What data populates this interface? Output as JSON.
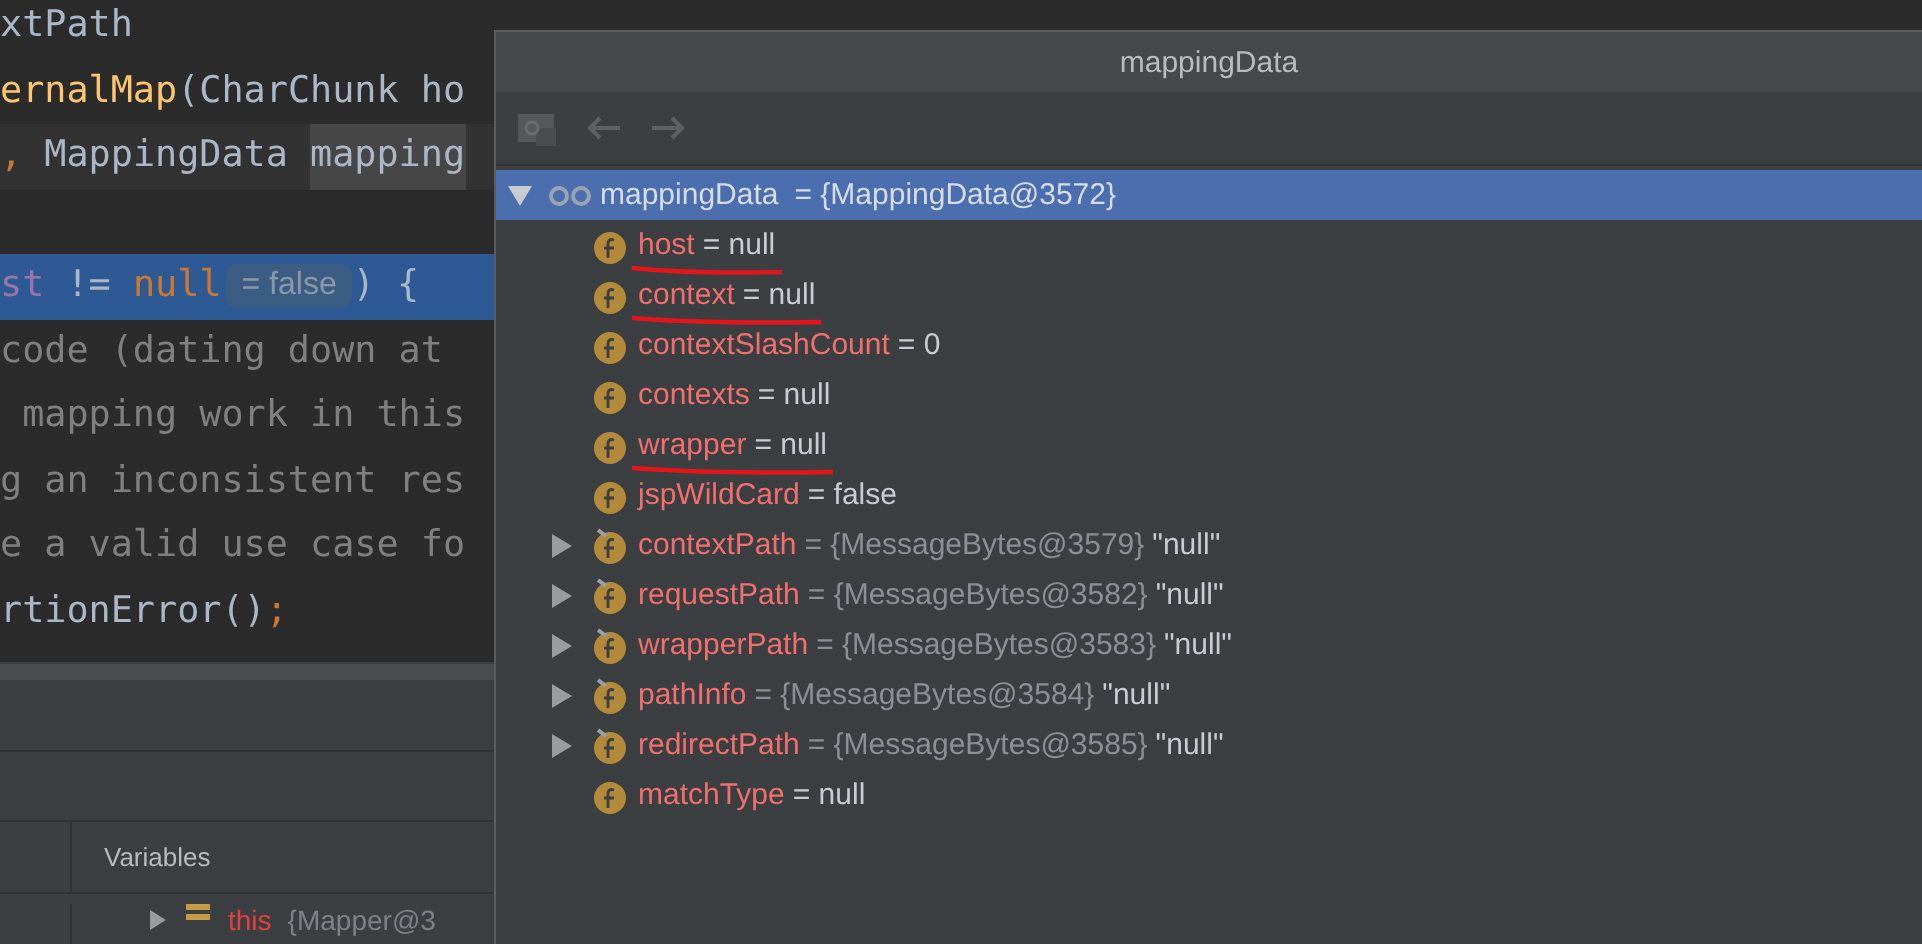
{
  "editor": {
    "lines": [
      {
        "current": false,
        "tokens": [
          {
            "text": "xtPath",
            "kind": "plain"
          }
        ]
      },
      {
        "current": false,
        "tokens": [
          {
            "text": "ernalMap",
            "kind": "method"
          },
          {
            "text": "(CharChunk ho",
            "kind": "plain"
          }
        ]
      },
      {
        "current": false,
        "tokens": [
          {
            "text": ",",
            "kind": "keyword"
          },
          {
            "text": " MappingData ",
            "kind": "plain"
          },
          {
            "text": "mapping",
            "kind": "usage"
          }
        ]
      },
      {
        "current": false
      },
      {
        "current": true,
        "tokens": [
          {
            "text": "st",
            "kind": "field"
          },
          {
            "text": " != ",
            "kind": "plain"
          },
          {
            "text": "null",
            "kind": "keyword"
          },
          {
            "text": "= false",
            "kind": "hint"
          },
          {
            "text": ") {",
            "kind": "plain"
          }
        ]
      },
      {
        "current": false,
        "tokens": [
          {
            "text": "code (dating down at",
            "kind": "comment"
          }
        ]
      },
      {
        "current": false,
        "tokens": [
          {
            "text": " mapping work in this",
            "kind": "comment"
          }
        ]
      },
      {
        "current": false,
        "tokens": [
          {
            "text": "g an inconsistent res",
            "kind": "comment"
          }
        ]
      },
      {
        "current": false,
        "tokens": [
          {
            "text": "e a valid use case fo",
            "kind": "comment"
          }
        ]
      },
      {
        "current": false,
        "tokens": [
          {
            "text": "rtionError()",
            "kind": "plain"
          },
          {
            "text": ";",
            "kind": "keyword"
          }
        ]
      }
    ]
  },
  "debug_panel": {
    "tab": "Variables",
    "row": {
      "name": "this",
      "value": "{Mapper@3"
    }
  },
  "popup": {
    "title": "mappingData",
    "root": {
      "name": "mappingData",
      "value": "= {MappingData@3572}",
      "expanded": true,
      "selected": true,
      "children": [
        {
          "name": "host",
          "value": "= null",
          "expandable": false,
          "underlined": true
        },
        {
          "name": "context",
          "value": "= null",
          "expandable": false,
          "underlined": true
        },
        {
          "name": "contextSlashCount",
          "value": "= 0",
          "expandable": false,
          "underlined": false
        },
        {
          "name": "contexts",
          "value": "= null",
          "expandable": false,
          "underlined": false
        },
        {
          "name": "wrapper",
          "value": "= null",
          "expandable": false,
          "underlined": true
        },
        {
          "name": "jspWildCard",
          "value": "= false",
          "expandable": false,
          "underlined": false
        },
        {
          "name": "contextPath",
          "ref": "= {MessageBytes@3579}",
          "value": "\"null\"",
          "expandable": true,
          "underlined": false
        },
        {
          "name": "requestPath",
          "ref": "= {MessageBytes@3582}",
          "value": "\"null\"",
          "expandable": true,
          "underlined": false
        },
        {
          "name": "wrapperPath",
          "ref": "= {MessageBytes@3583}",
          "value": "\"null\"",
          "expandable": true,
          "underlined": false
        },
        {
          "name": "pathInfo",
          "ref": "= {MessageBytes@3584}",
          "value": "\"null\"",
          "expandable": true,
          "underlined": false
        },
        {
          "name": "redirectPath",
          "ref": "= {MessageBytes@3585}",
          "value": "\"null\"",
          "expandable": true,
          "underlined": false
        },
        {
          "name": "matchType",
          "value": "= null",
          "expandable": false,
          "underlined": false
        }
      ]
    }
  }
}
